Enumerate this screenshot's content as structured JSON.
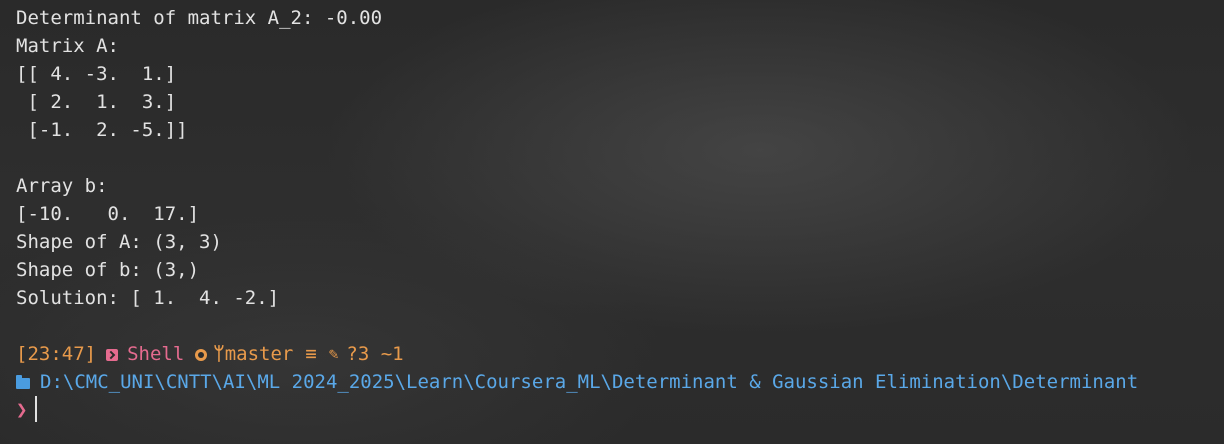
{
  "output_lines": [
    "Determinant of matrix A_2: -0.00",
    "Matrix A:",
    "[[ 4. -3.  1.]",
    " [ 2.  1.  3.]",
    " [-1.  2. -5.]]",
    "",
    "Array b:",
    "[-10.   0.  17.]",
    "Shape of A: (3, 3)",
    "Shape of b: (3,)",
    "Solution: [ 1.  4. -2.]"
  ],
  "prompt": {
    "time": "[23:47]",
    "shell_label": "Shell",
    "branch": "master",
    "sync_symbol": "≡",
    "edit_symbol": "✎",
    "git_status": "?3 ~1",
    "cwd": "D:\\CMC_UNI\\CNTT\\AI\\ML 2024_2025\\Learn\\Coursera_ML\\Determinant & Gaussian Elimination\\Determinant",
    "input_symbol": "❯"
  },
  "colors": {
    "background": "#2b2b2b",
    "text": "#e2e2e2",
    "accent_orange": "#e89a4b",
    "accent_pink": "#e56b8f",
    "path_blue": "#5aa8e8"
  },
  "icons": [
    "shell-icon",
    "github-icon",
    "branch-icon",
    "edit-icon",
    "folder-icon",
    "chevron-right-icon"
  ]
}
